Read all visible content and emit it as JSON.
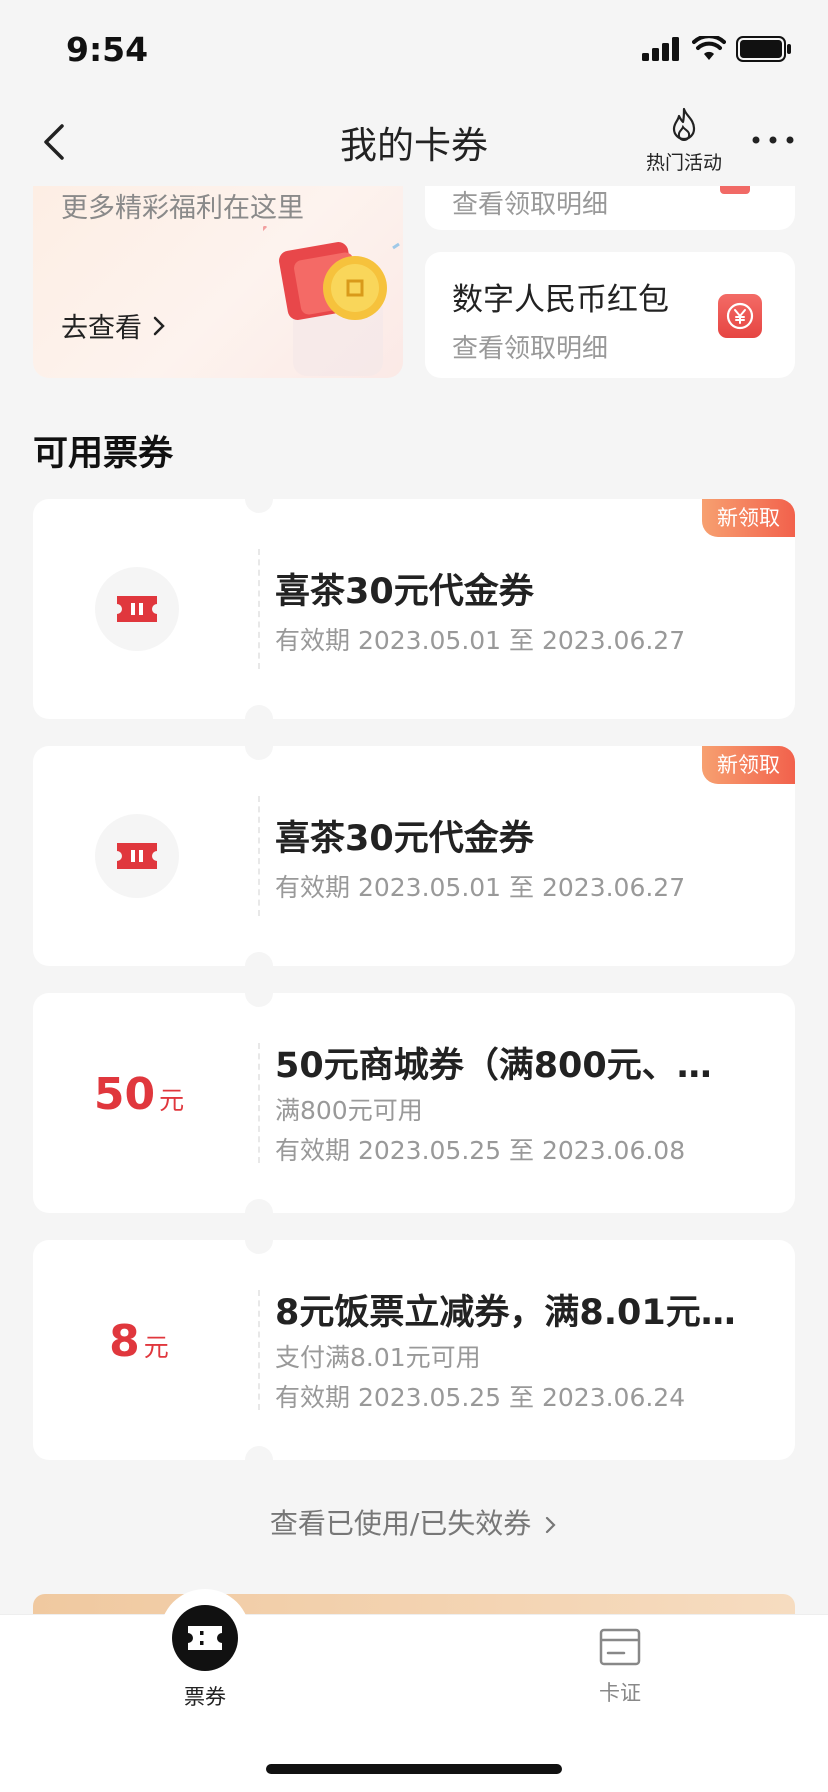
{
  "status_bar": {
    "time": "9:54"
  },
  "nav": {
    "title": "我的卡券",
    "hot_label": "热门活动"
  },
  "promo": {
    "subtitle": "更多精彩福利在这里",
    "link_label": "去查看"
  },
  "side_top": {
    "subtitle": "查看领取明细"
  },
  "side_card": {
    "title": "数字人民币红包",
    "subtitle": "查看领取明细"
  },
  "section_title": "可用票券",
  "coupons": [
    {
      "badge": "新领取",
      "title": "喜茶30元代金券",
      "validity": "有效期 2023.05.01 至 2023.06.27"
    },
    {
      "badge": "新领取",
      "title": "喜茶30元代金券",
      "validity": "有效期 2023.05.01 至 2023.06.27"
    },
    {
      "amount": "50",
      "unit": "元",
      "title": "50元商城券（满800元、…",
      "condition": "满800元可用",
      "validity": "有效期 2023.05.25 至 2023.06.08"
    },
    {
      "amount": "8",
      "unit": "元",
      "title": "8元饭票立减券，满8.01元…",
      "condition": "支付满8.01元可用",
      "validity": "有效期 2023.05.25 至 2023.06.24"
    }
  ],
  "view_used": "查看已使用/已失效券",
  "tabs": [
    {
      "label": "票券",
      "active": true
    },
    {
      "label": "卡证",
      "active": false
    }
  ],
  "colors": {
    "accent_red": "#e0373d",
    "badge_gradient": [
      "#f7a070",
      "#f2614c"
    ],
    "background": "#f5f5f5"
  },
  "icons": [
    "back-arrow-icon",
    "flame-icon",
    "more-icon",
    "yuan-icon",
    "ticket-icon",
    "card-icon",
    "signal-icon",
    "wifi-icon",
    "battery-icon"
  ]
}
